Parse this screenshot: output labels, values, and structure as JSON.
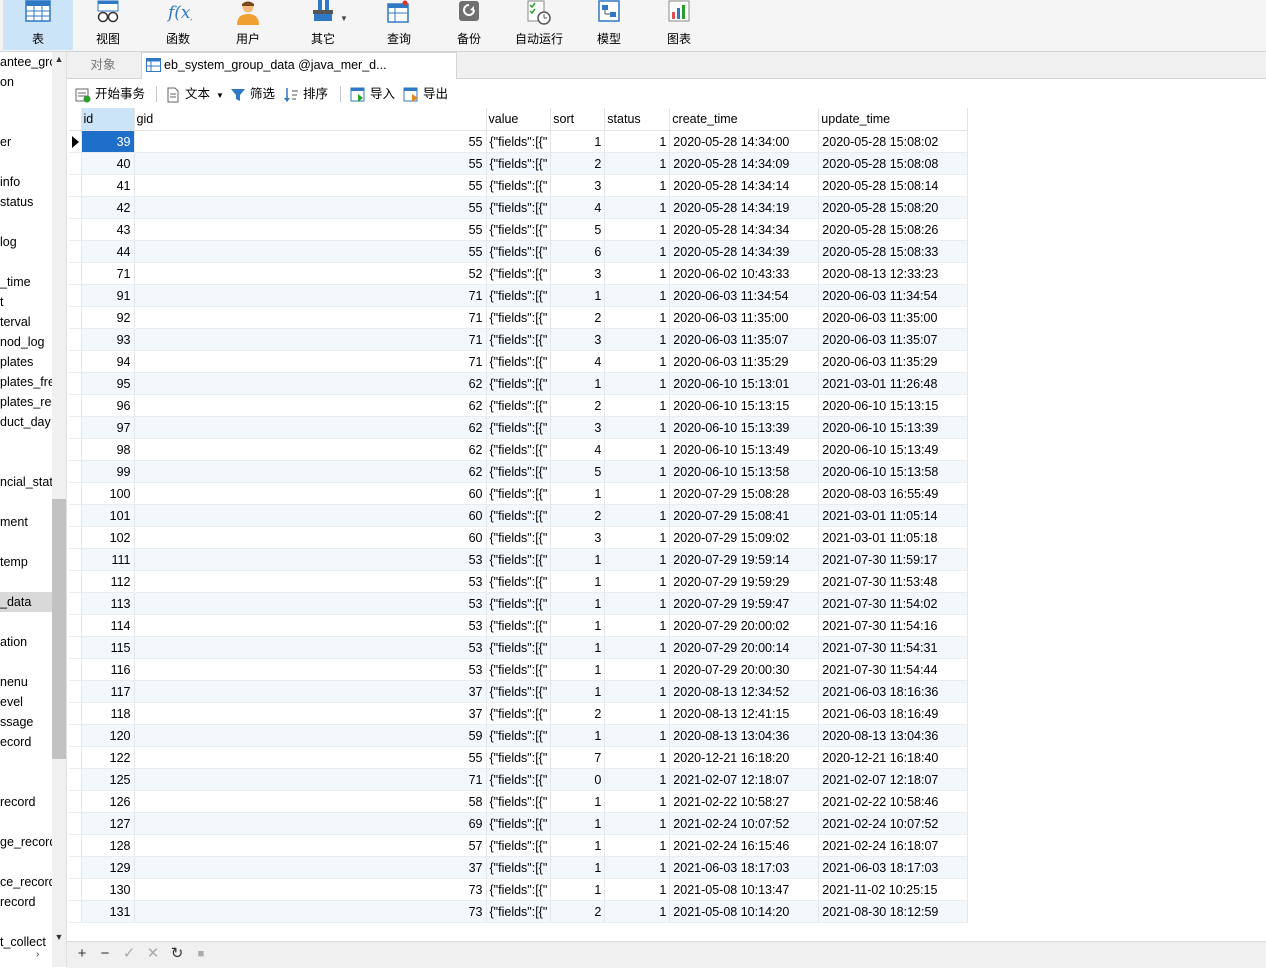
{
  "toolbar": {
    "items": [
      {
        "label": "表",
        "icon": "table-grid-icon"
      },
      {
        "label": "视图",
        "icon": "glasses-icon"
      },
      {
        "label": "函数",
        "icon": "function-fx-icon"
      },
      {
        "label": "用户",
        "icon": "user-icon"
      },
      {
        "label": "其它",
        "icon": "tools-icon"
      },
      {
        "label": "查询",
        "icon": "query-icon"
      },
      {
        "label": "备份",
        "icon": "backup-icon"
      },
      {
        "label": "自动运行",
        "icon": "auto-run-icon"
      },
      {
        "label": "模型",
        "icon": "model-icon"
      },
      {
        "label": "图表",
        "icon": "chart-icon"
      }
    ]
  },
  "sidebar": {
    "items": [
      "antee_grc",
      "on",
      "er",
      "info",
      "status",
      "log",
      "_time",
      "t",
      "terval",
      "nod_log",
      "plates",
      "plates_fre",
      "plates_reg",
      "duct_day",
      "ncial_stat",
      "ment",
      "temp",
      "_data",
      "ation",
      "nenu",
      "evel",
      "ssage",
      "ecord",
      "record",
      "ge_record",
      "ce_record",
      "record",
      "t_collect"
    ]
  },
  "tabs": {
    "objects_label": "对象",
    "active_label": "eb_system_group_data @java_mer_d..."
  },
  "subtoolbar": {
    "begin_transaction": "开始事务",
    "text": "文本",
    "filter": "筛选",
    "sort": "排序",
    "import": "导入",
    "export": "导出"
  },
  "table": {
    "columns": [
      "id",
      "gid",
      "value",
      "sort",
      "status",
      "create_time",
      "update_time"
    ],
    "rows": [
      [
        "39",
        "55",
        "{\"fields\":[{\"",
        "1",
        "1",
        "2020-05-28 14:34:00",
        "2020-05-28 15:08:02"
      ],
      [
        "40",
        "55",
        "{\"fields\":[{\"",
        "2",
        "1",
        "2020-05-28 14:34:09",
        "2020-05-28 15:08:08"
      ],
      [
        "41",
        "55",
        "{\"fields\":[{\"",
        "3",
        "1",
        "2020-05-28 14:34:14",
        "2020-05-28 15:08:14"
      ],
      [
        "42",
        "55",
        "{\"fields\":[{\"",
        "4",
        "1",
        "2020-05-28 14:34:19",
        "2020-05-28 15:08:20"
      ],
      [
        "43",
        "55",
        "{\"fields\":[{\"",
        "5",
        "1",
        "2020-05-28 14:34:34",
        "2020-05-28 15:08:26"
      ],
      [
        "44",
        "55",
        "{\"fields\":[{\"",
        "6",
        "1",
        "2020-05-28 14:34:39",
        "2020-05-28 15:08:33"
      ],
      [
        "71",
        "52",
        "{\"fields\":[{\"",
        "3",
        "1",
        "2020-06-02 10:43:33",
        "2020-08-13 12:33:23"
      ],
      [
        "91",
        "71",
        "{\"fields\":[{\"",
        "1",
        "1",
        "2020-06-03 11:34:54",
        "2020-06-03 11:34:54"
      ],
      [
        "92",
        "71",
        "{\"fields\":[{\"",
        "2",
        "1",
        "2020-06-03 11:35:00",
        "2020-06-03 11:35:00"
      ],
      [
        "93",
        "71",
        "{\"fields\":[{\"",
        "3",
        "1",
        "2020-06-03 11:35:07",
        "2020-06-03 11:35:07"
      ],
      [
        "94",
        "71",
        "{\"fields\":[{\"",
        "4",
        "1",
        "2020-06-03 11:35:29",
        "2020-06-03 11:35:29"
      ],
      [
        "95",
        "62",
        "{\"fields\":[{\"",
        "1",
        "1",
        "2020-06-10 15:13:01",
        "2021-03-01 11:26:48"
      ],
      [
        "96",
        "62",
        "{\"fields\":[{\"",
        "2",
        "1",
        "2020-06-10 15:13:15",
        "2020-06-10 15:13:15"
      ],
      [
        "97",
        "62",
        "{\"fields\":[{\"",
        "3",
        "1",
        "2020-06-10 15:13:39",
        "2020-06-10 15:13:39"
      ],
      [
        "98",
        "62",
        "{\"fields\":[{\"",
        "4",
        "1",
        "2020-06-10 15:13:49",
        "2020-06-10 15:13:49"
      ],
      [
        "99",
        "62",
        "{\"fields\":[{\"",
        "5",
        "1",
        "2020-06-10 15:13:58",
        "2020-06-10 15:13:58"
      ],
      [
        "100",
        "60",
        "{\"fields\":[{\"",
        "1",
        "1",
        "2020-07-29 15:08:28",
        "2020-08-03 16:55:49"
      ],
      [
        "101",
        "60",
        "{\"fields\":[{\"",
        "2",
        "1",
        "2020-07-29 15:08:41",
        "2021-03-01 11:05:14"
      ],
      [
        "102",
        "60",
        "{\"fields\":[{\"",
        "3",
        "1",
        "2020-07-29 15:09:02",
        "2021-03-01 11:05:18"
      ],
      [
        "111",
        "53",
        "{\"fields\":[{\"",
        "1",
        "1",
        "2020-07-29 19:59:14",
        "2021-07-30 11:59:17"
      ],
      [
        "112",
        "53",
        "{\"fields\":[{\"",
        "1",
        "1",
        "2020-07-29 19:59:29",
        "2021-07-30 11:53:48"
      ],
      [
        "113",
        "53",
        "{\"fields\":[{\"",
        "1",
        "1",
        "2020-07-29 19:59:47",
        "2021-07-30 11:54:02"
      ],
      [
        "114",
        "53",
        "{\"fields\":[{\"",
        "1",
        "1",
        "2020-07-29 20:00:02",
        "2021-07-30 11:54:16"
      ],
      [
        "115",
        "53",
        "{\"fields\":[{\"",
        "1",
        "1",
        "2020-07-29 20:00:14",
        "2021-07-30 11:54:31"
      ],
      [
        "116",
        "53",
        "{\"fields\":[{\"",
        "1",
        "1",
        "2020-07-29 20:00:30",
        "2021-07-30 11:54:44"
      ],
      [
        "117",
        "37",
        "{\"fields\":[{\"",
        "1",
        "1",
        "2020-08-13 12:34:52",
        "2021-06-03 18:16:36"
      ],
      [
        "118",
        "37",
        "{\"fields\":[{\"",
        "2",
        "1",
        "2020-08-13 12:41:15",
        "2021-06-03 18:16:49"
      ],
      [
        "120",
        "59",
        "{\"fields\":[{\"",
        "1",
        "1",
        "2020-08-13 13:04:36",
        "2020-08-13 13:04:36"
      ],
      [
        "122",
        "55",
        "{\"fields\":[{\"",
        "7",
        "1",
        "2020-12-21 16:18:20",
        "2020-12-21 16:18:40"
      ],
      [
        "125",
        "71",
        "{\"fields\":[{\"",
        "0",
        "1",
        "2021-02-07 12:18:07",
        "2021-02-07 12:18:07"
      ],
      [
        "126",
        "58",
        "{\"fields\":[{\"",
        "1",
        "1",
        "2021-02-22 10:58:27",
        "2021-02-22 10:58:46"
      ],
      [
        "127",
        "69",
        "{\"fields\":[{\"",
        "1",
        "1",
        "2021-02-24 10:07:52",
        "2021-02-24 10:07:52"
      ],
      [
        "128",
        "57",
        "{\"fields\":[{\"",
        "1",
        "1",
        "2021-02-24 16:15:46",
        "2021-02-24 16:18:07"
      ],
      [
        "129",
        "37",
        "{\"fields\":[{\"",
        "1",
        "1",
        "2021-06-03 18:17:03",
        "2021-06-03 18:17:03"
      ],
      [
        "130",
        "73",
        "{\"fields\":[{\"",
        "1",
        "1",
        "2021-05-08 10:13:47",
        "2021-11-02 10:25:15"
      ],
      [
        "131",
        "73",
        "{\"fields\":[{\"",
        "2",
        "1",
        "2021-05-08 10:14:20",
        "2021-08-30 18:12:59"
      ]
    ]
  },
  "bottombar": {
    "add": "+",
    "remove": "−",
    "apply": "✓",
    "discard": "✕",
    "refresh": "↻",
    "stop": "■"
  },
  "colors": {
    "selection": "#1e6fc9",
    "toolbar_active": "#cce4f7",
    "alt_row": "#f3f8fd"
  }
}
